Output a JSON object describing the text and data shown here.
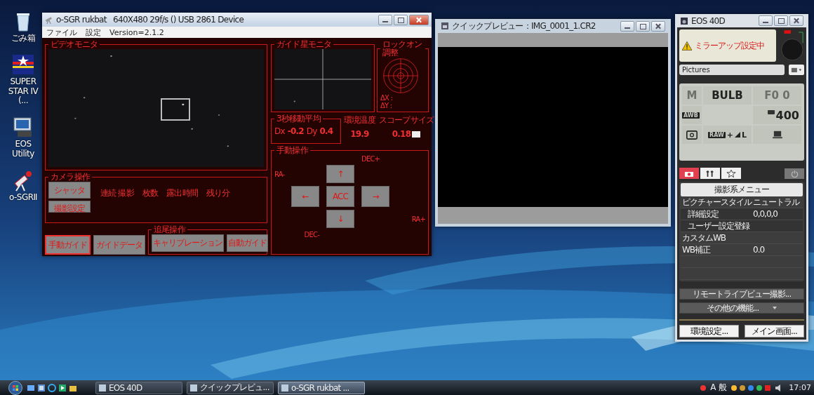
{
  "desktop_icons": [
    {
      "label": "ごみ箱",
      "kind": "trash"
    },
    {
      "label": "SUPER STAR IV (...",
      "kind": "superstar"
    },
    {
      "label": "EOS Utility",
      "kind": "eos"
    },
    {
      "label": "o-SGRⅡ",
      "kind": "sgr"
    }
  ],
  "sgr_window": {
    "title": "o-SGR rukbat   640X480 29f/s () USB 2861 Device",
    "menu": [
      "ファイル",
      "設定",
      "Version=2.1.2"
    ],
    "video_monitor": {
      "title": "ビデオモニタ"
    },
    "guide_monitor": {
      "title": "ガイド星モニタ"
    },
    "lock_on": {
      "title": "ロックオン調整",
      "dx": "ΔX :",
      "dy": "ΔY :"
    },
    "moving_average": {
      "title": "3秒移動平均",
      "fields": [
        {
          "label": "Dx",
          "value": "-0.2"
        },
        {
          "label": "Dy",
          "value": "0.4"
        }
      ]
    },
    "readouts": [
      {
        "label": "環境温度",
        "value": "19.9"
      },
      {
        "label": "スコープサイズ",
        "value": "0.18"
      }
    ],
    "manual": {
      "title": "手動操作",
      "dec_plus": "DEC+",
      "ra_minus": "RA-",
      "ra_plus": "RA+",
      "dec_minus": "DEC-",
      "up": "↑",
      "left": "←",
      "center": "ACC",
      "right": "→",
      "down": "↓"
    },
    "camera": {
      "title": "カメラ操作",
      "buttons": [
        "シャッタ",
        "撮影設定"
      ],
      "columns": [
        "連続 撮影",
        "枚数",
        "露出時間",
        "残り分"
      ]
    },
    "bottom_buttons": [
      {
        "label": "手動ガイド",
        "selected": true
      },
      {
        "label": "ガイドデータ",
        "selected": false
      }
    ],
    "tracking": {
      "title": "追尾操作",
      "buttons": [
        "キャリブレーション",
        "自動ガイド"
      ]
    }
  },
  "preview_window": {
    "title": "クイックプレビュー：IMG_0001_1.CR2"
  },
  "eos_window": {
    "title": "EOS 40D",
    "warning": "ミラーアップ設定中",
    "folder": "Pictures",
    "mode": {
      "text": "M",
      "dimmed": true
    },
    "shutter": {
      "text": "BULB",
      "dimmed": false
    },
    "aperture": {
      "text": "F0 0",
      "dimmed": true
    },
    "white_balance": "AWB",
    "iso": "400",
    "quality": "RAW",
    "quality_suffix": "+",
    "quality_size": "L",
    "tabs": [
      {
        "kind": "camera",
        "selected": true
      },
      {
        "kind": "tools",
        "selected": false
      },
      {
        "kind": "star",
        "selected": false
      }
    ],
    "menu": {
      "title": "撮影系メニュー",
      "rows": [
        {
          "label": "ピクチャースタイル",
          "value": "ニュートラル",
          "children": [
            {
              "label": "詳細設定",
              "value": "0,0,0,0"
            },
            {
              "label": "ユーザー設定登録"
            }
          ]
        },
        {
          "label": "カスタムWB"
        },
        {
          "label": "WB補正",
          "value": "0.0"
        }
      ]
    },
    "action_buttons": [
      {
        "label": "リモートライブビュー撮影...",
        "kind": "plain"
      },
      {
        "label": "その他の機能...",
        "kind": "dropdown"
      }
    ],
    "footer_buttons": [
      "環境設定...",
      "メイン画面..."
    ]
  },
  "taskbar": {
    "tasks": [
      {
        "label": "EOS 40D",
        "selected": false
      },
      {
        "label": "クイックプレビュ...",
        "selected": false
      },
      {
        "label": "o-SGR rukbat  ...",
        "selected": true
      }
    ],
    "tray": "A 般",
    "clock": "17:07"
  }
}
